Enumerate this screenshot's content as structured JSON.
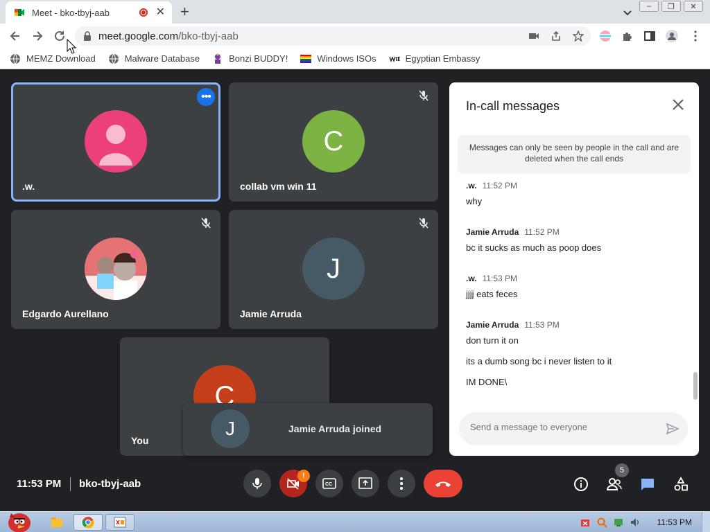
{
  "browser": {
    "tab_title": "Meet - bko-tbyj-aab",
    "tab_close": "✕",
    "new_tab": "+",
    "url_domain": "meet.google.com",
    "url_path": "/bko-tbyj-aab",
    "window_buttons": [
      "–",
      "❐",
      "✕"
    ]
  },
  "bookmarks": [
    {
      "label": "MEMZ Download",
      "icon": "globe-icon"
    },
    {
      "label": "Malware Database",
      "icon": "globe-icon"
    },
    {
      "label": "Bonzi BUDDY!",
      "icon": "bonzi-icon"
    },
    {
      "label": "Windows ISOs",
      "icon": "rainbow-flag-icon"
    },
    {
      "label": "Egyptian Embassy",
      "icon": "wix-icon"
    }
  ],
  "participants": {
    "w": {
      "name": ".w.",
      "avatar_color": "#ec407a"
    },
    "collab": {
      "name": "collab vm win 11",
      "initial": "C",
      "avatar_color": "#7cb342"
    },
    "edgardo": {
      "name": "Edgardo Aurellano"
    },
    "jamie": {
      "name": "Jamie Arruda",
      "initial": "J",
      "avatar_color": "#455a64"
    },
    "you": {
      "name": "You",
      "initial": "C",
      "avatar_color": "#c5401a"
    }
  },
  "toast": {
    "initial": "J",
    "text": "Jamie Arruda joined"
  },
  "chat": {
    "title": "In-call messages",
    "notice": "Messages can only be seen by people in the call and are deleted when the call ends",
    "messages": [
      {
        "sender": ".w.",
        "time": "11:52 PM",
        "lines": [
          "why"
        ]
      },
      {
        "sender": "Jamie Arruda",
        "time": "11:52 PM",
        "lines": [
          "bc it sucks as much as poop does"
        ]
      },
      {
        "sender": ".w.",
        "time": "11:53 PM",
        "lines": [
          "jjjj eats feces"
        ]
      },
      {
        "sender": "Jamie Arruda",
        "time": "11:53 PM",
        "lines": [
          "don turn it on",
          "its a dumb song bc i never listen to it",
          "IM DONE\\"
        ]
      }
    ],
    "input_placeholder": "Send a message to everyone"
  },
  "call": {
    "time": "11:53 PM",
    "meeting_code": "bko-tbyj-aab",
    "camera_warning": "!",
    "people_count": "5"
  },
  "taskbar": {
    "clock": "11:53 PM"
  },
  "colors": {
    "accent": "#1a73e8",
    "hangup": "#ea4335",
    "warning": "#fa7b17"
  }
}
